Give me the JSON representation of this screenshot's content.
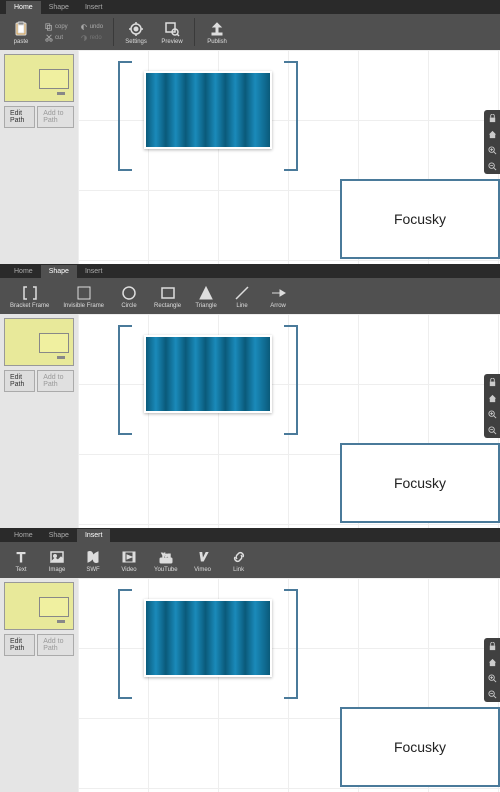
{
  "tabs": {
    "home": "Home",
    "shape": "Shape",
    "insert": "Insert"
  },
  "home": {
    "paste": "paste",
    "copy": "copy",
    "cut": "cut",
    "undo": "undo",
    "redo": "redo",
    "settings": "Settings",
    "preview": "Preview",
    "publish": "Publish"
  },
  "shape": {
    "bracket": "Bracket Frame",
    "invisible": "Invisible Frame",
    "circle": "Circle",
    "rectangle": "Rectangle",
    "triangle": "Triangle",
    "line": "Line",
    "arrow": "Arrow"
  },
  "insert": {
    "text": "Text",
    "image": "Image",
    "swf": "SWF",
    "video": "Video",
    "youtube": "YouTube",
    "vimeo": "Vimeo",
    "link": "Link"
  },
  "sidebar": {
    "editPath": "Edit Path",
    "addToPath": "Add to Path"
  },
  "watermark": "Focusky"
}
